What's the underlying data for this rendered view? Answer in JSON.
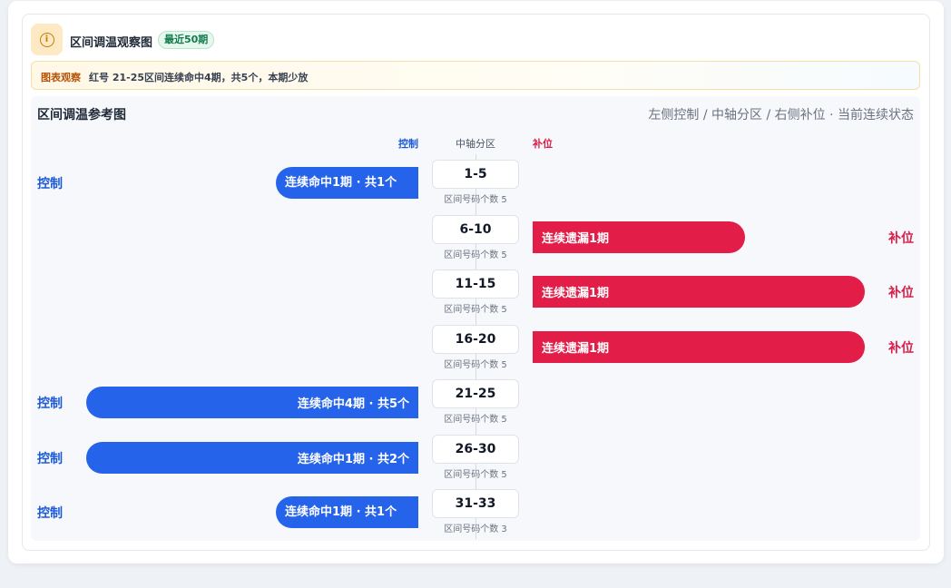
{
  "header": {
    "icon": "info-icon",
    "title": "区间调温观察图",
    "badge": "最近50期"
  },
  "notice": {
    "tag": "图表观察",
    "text": "红号 21-25区间连续命中4期，共5个，本期少放"
  },
  "panel": {
    "title": "区间调温参考图",
    "legend": "左侧控制 / 中轴分区 / 右侧补位 · 当前连续状态",
    "columns": {
      "left": "控制",
      "center": "中轴分区",
      "right": "补位"
    }
  },
  "colors": {
    "control": "#2563eb",
    "fill": "#e11d48",
    "accent": "#c87a04"
  },
  "chart_data": {
    "type": "bar",
    "categories": [
      "1-5",
      "6-10",
      "11-15",
      "16-20",
      "21-25",
      "26-30",
      "31-33"
    ],
    "rows": [
      {
        "zone": "1-5",
        "sub": "区间号码个数 5",
        "side": "control",
        "label": "控制",
        "bar_text": "连续命中1期 · 共1个",
        "streak": 1,
        "count": 1
      },
      {
        "zone": "6-10",
        "sub": "区间号码个数 5",
        "side": "fill",
        "label": "补位",
        "bar_text": "连续遗漏1期",
        "streak": 1
      },
      {
        "zone": "11-15",
        "sub": "区间号码个数 5",
        "side": "fill",
        "label": "补位",
        "bar_text": "连续遗漏1期",
        "streak": 1
      },
      {
        "zone": "16-20",
        "sub": "区间号码个数 5",
        "side": "fill",
        "label": "补位",
        "bar_text": "连续遗漏1期",
        "streak": 1
      },
      {
        "zone": "21-25",
        "sub": "区间号码个数 5",
        "side": "control",
        "label": "控制",
        "bar_text": "连续命中4期 · 共5个",
        "streak": 4,
        "count": 5
      },
      {
        "zone": "26-30",
        "sub": "区间号码个数 5",
        "side": "control",
        "label": "控制",
        "bar_text": "连续命中1期 · 共2个",
        "streak": 1,
        "count": 2
      },
      {
        "zone": "31-33",
        "sub": "区间号码个数 3",
        "side": "control",
        "label": "控制",
        "bar_text": "连续命中1期 · 共1个",
        "streak": 1,
        "count": 1
      }
    ]
  }
}
